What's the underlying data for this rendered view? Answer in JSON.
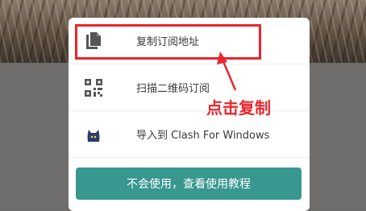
{
  "menu": {
    "items": [
      {
        "label": "复制订阅地址",
        "icon": "copy-icon"
      },
      {
        "label": "扫描二维码订阅",
        "icon": "qr-code-icon"
      },
      {
        "label": "导入到 Clash For Windows",
        "icon": "clash-cat-icon"
      }
    ]
  },
  "annotation": {
    "text": "点击复制",
    "color": "#e8262c"
  },
  "help_button": {
    "label": "不会使用，查看使用教程",
    "color": "#38978f"
  }
}
